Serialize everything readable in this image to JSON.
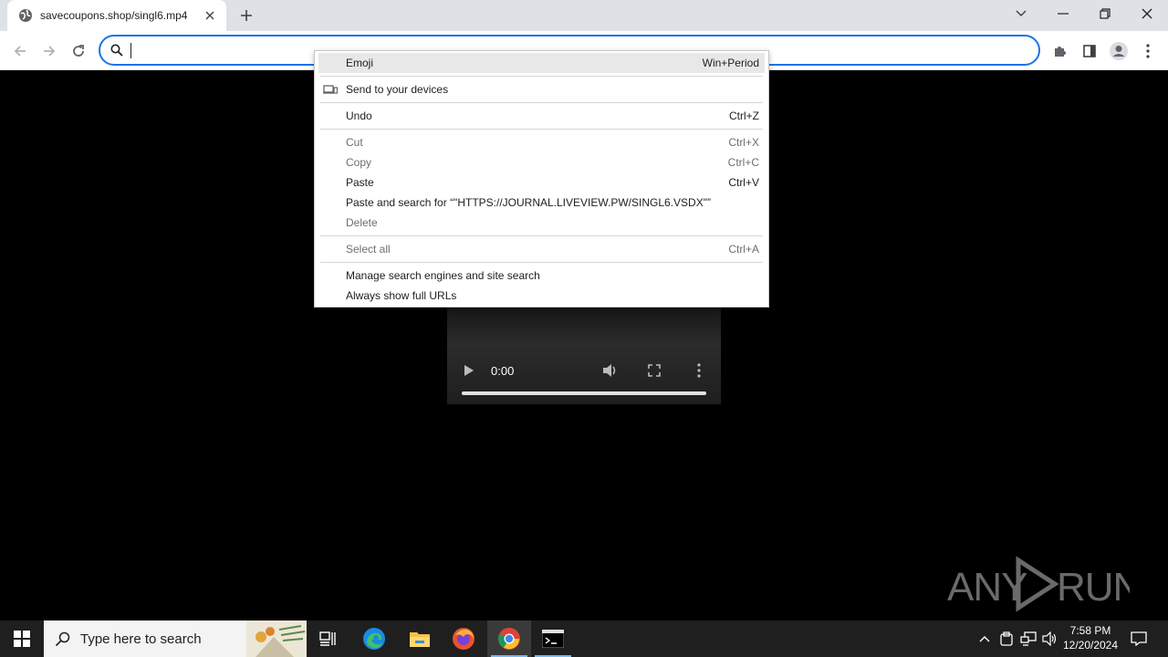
{
  "browser": {
    "tab": {
      "title": "savecoupons.shop/singl6.mp4"
    },
    "omnibox": {
      "value": ""
    }
  },
  "context_menu": {
    "items": [
      {
        "label": "Emoji",
        "shortcut": "Win+Period"
      },
      {
        "label": "Send to your devices",
        "shortcut": ""
      },
      {
        "label": "Undo",
        "shortcut": "Ctrl+Z"
      },
      {
        "label": "Cut",
        "shortcut": "Ctrl+X"
      },
      {
        "label": "Copy",
        "shortcut": "Ctrl+C"
      },
      {
        "label": "Paste",
        "shortcut": "Ctrl+V"
      },
      {
        "label": "Paste and search for “\"HTTPS://JOURNAL.LIVEVIEW.PW/SINGL6.VSDX\"”",
        "shortcut": ""
      },
      {
        "label": "Delete",
        "shortcut": ""
      },
      {
        "label": "Select all",
        "shortcut": "Ctrl+A"
      },
      {
        "label": "Manage search engines and site search",
        "shortcut": ""
      },
      {
        "label": "Always show full URLs",
        "shortcut": ""
      }
    ]
  },
  "video": {
    "time": "0:00",
    "progress": 0
  },
  "watermark": {
    "text": "ANY RUN"
  },
  "taskbar": {
    "search_placeholder": "Type here to search",
    "clock_time": "7:58 PM",
    "clock_date": "12/20/2024"
  },
  "colors": {
    "accent": "#1a73e8",
    "tabstrip": "#dee1e6",
    "taskbar": "#1f1f1f"
  }
}
